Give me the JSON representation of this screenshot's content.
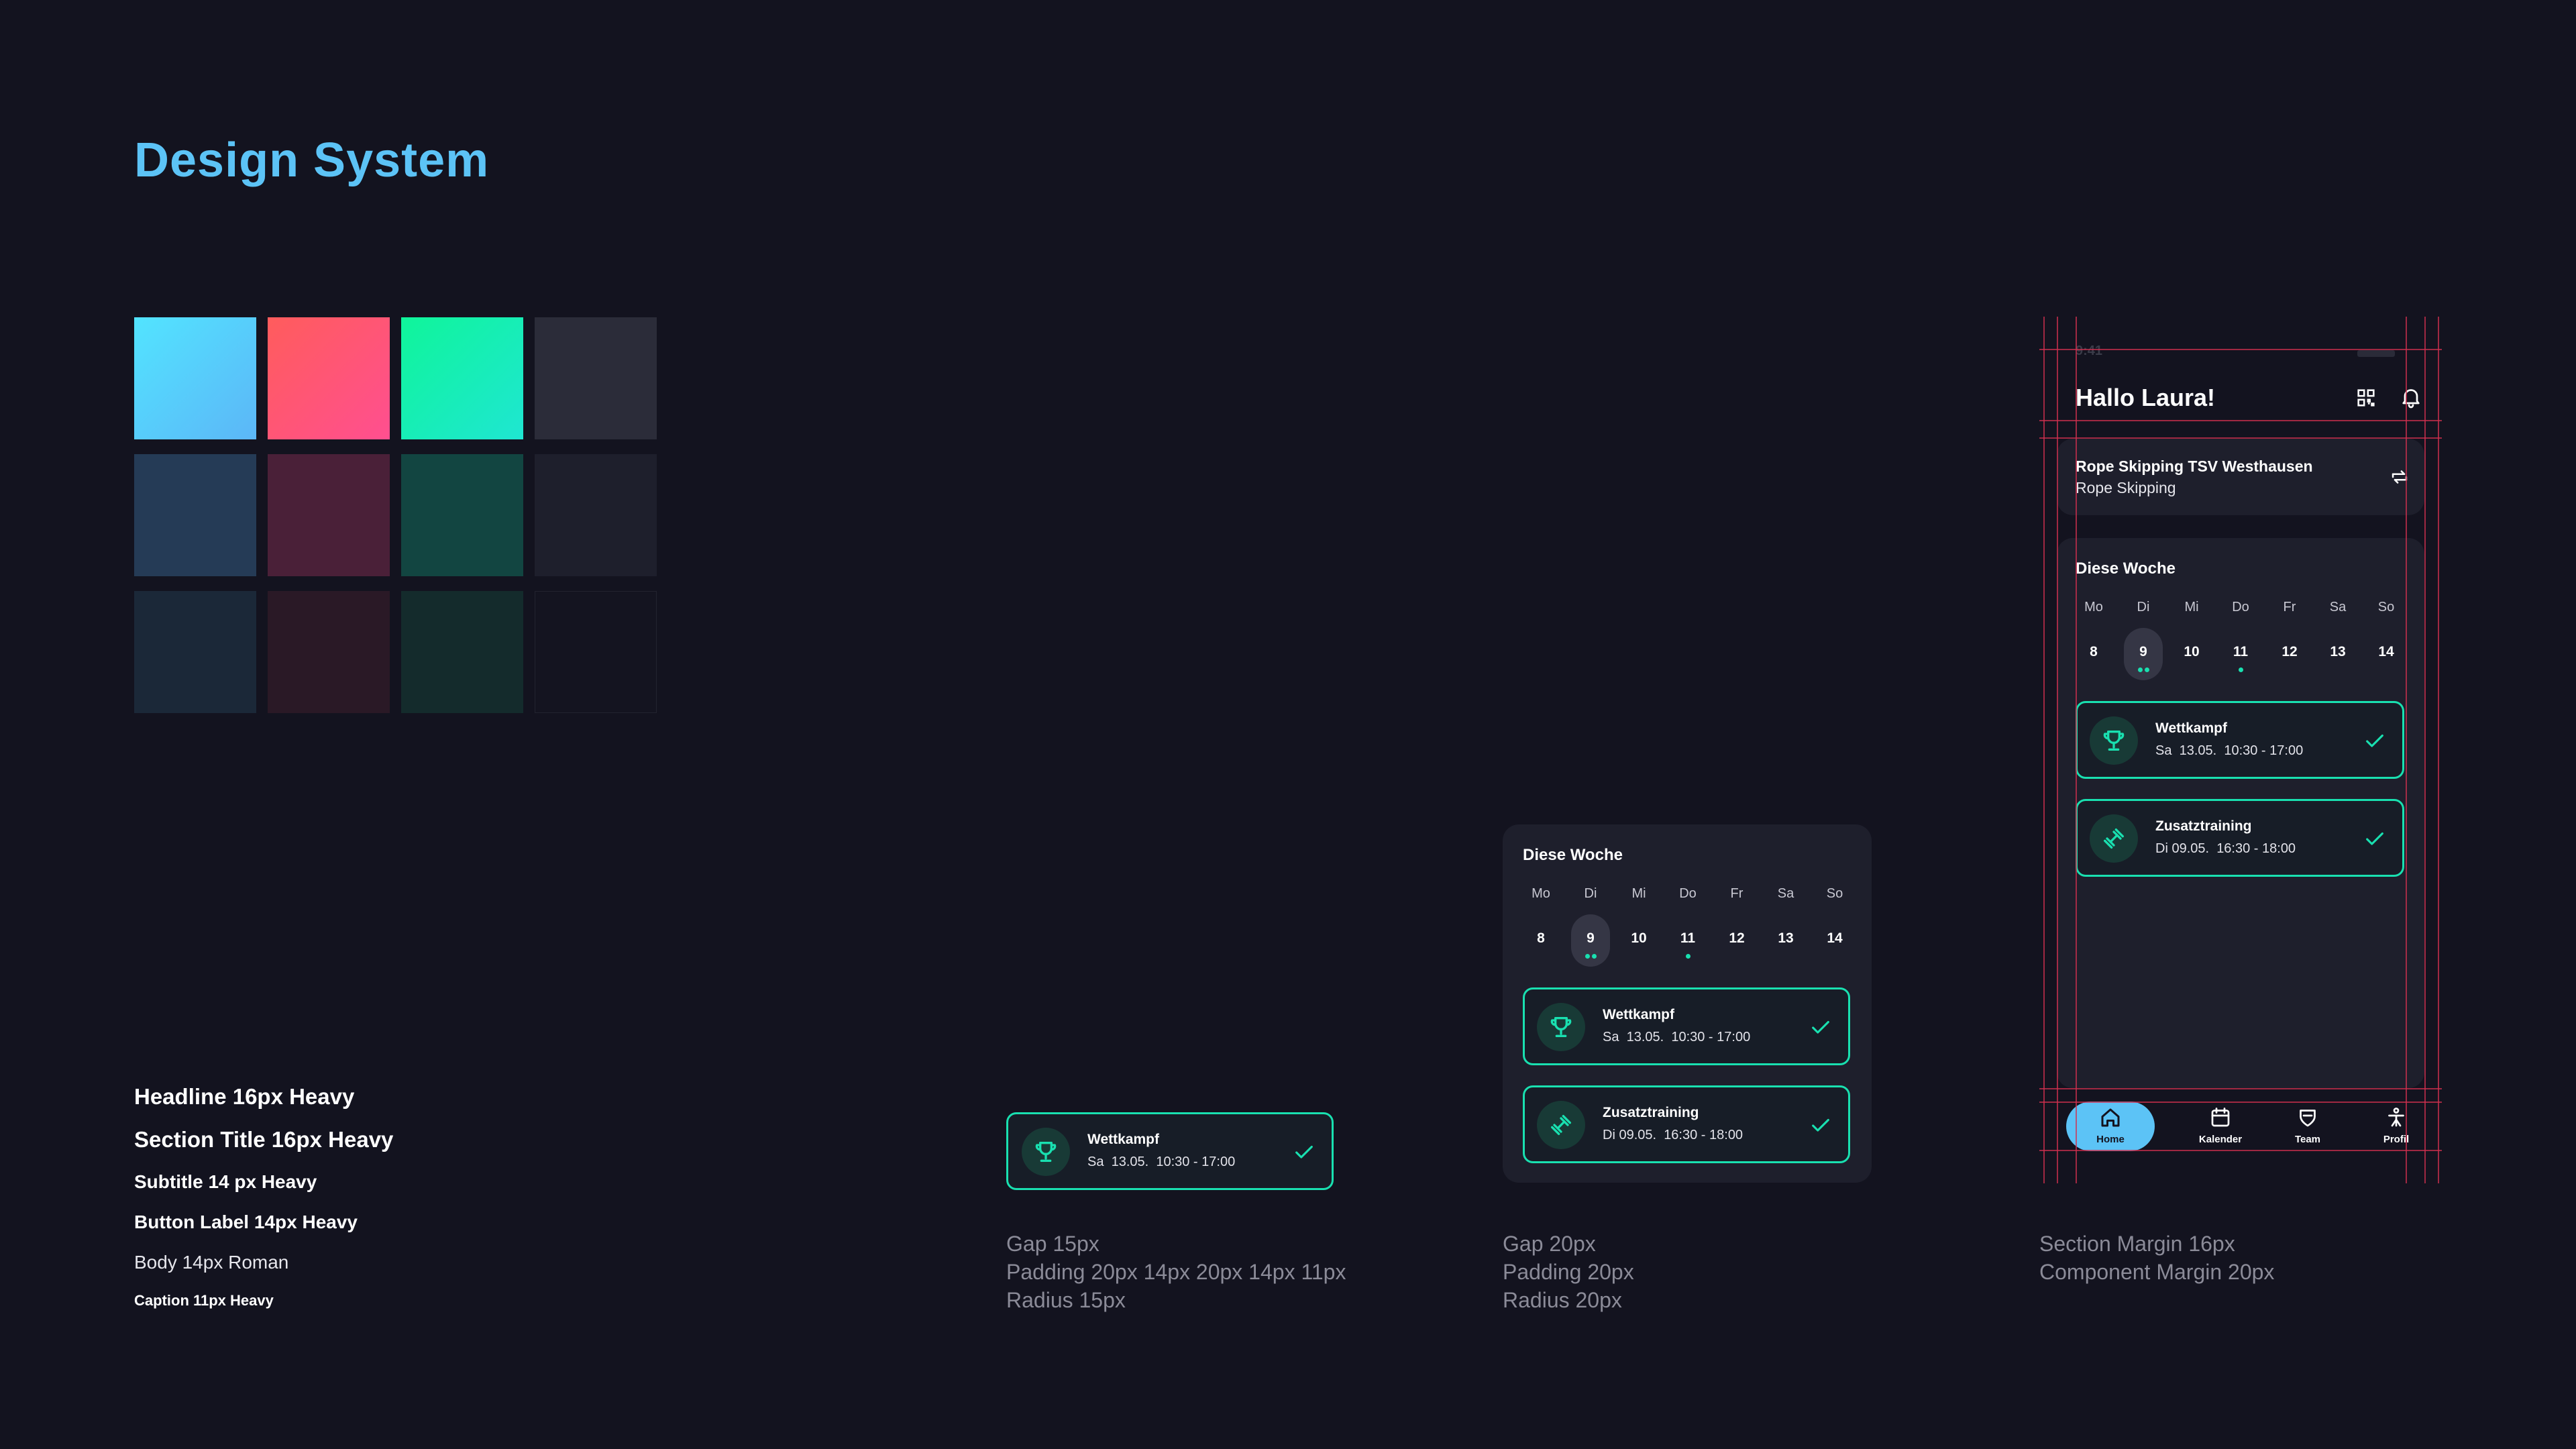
{
  "page": {
    "title": "Design System"
  },
  "colors": {
    "row1": [
      "#4fd8fb",
      "#fa5a6e",
      "#17f5b2",
      "#2b2c39"
    ],
    "row2": [
      "#253b56",
      "#4a2038",
      "#124541",
      "#1e1f2c"
    ],
    "row3": [
      "#1b2838",
      "#2a1926",
      "#142b2c",
      "#141420"
    ]
  },
  "typography": {
    "headline": "Headline 16px Heavy",
    "section_title": "Section Title 16px Heavy",
    "subtitle": "Subtitle 14 px Heavy",
    "button_label": "Button Label 14px Heavy",
    "body": "Body 14px Roman",
    "caption": "Caption 11px Heavy"
  },
  "card_spec": {
    "event": {
      "title": "Wettkampf",
      "day": "Sa",
      "date": "13.05.",
      "time": "10:30 - 17:00",
      "icon": "trophy-icon"
    },
    "lines": [
      "Gap 15px",
      "Padding 20px 14px 20px 14px 11px",
      "Radius 15px"
    ]
  },
  "week": {
    "title": "Diese Woche",
    "days": [
      {
        "label": "Mo",
        "num": "8",
        "selected": false,
        "dots": 0
      },
      {
        "label": "Di",
        "num": "9",
        "selected": true,
        "dots": 2
      },
      {
        "label": "Mi",
        "num": "10",
        "selected": false,
        "dots": 0
      },
      {
        "label": "Do",
        "num": "11",
        "selected": false,
        "dots": 1
      },
      {
        "label": "Fr",
        "num": "12",
        "selected": false,
        "dots": 0
      },
      {
        "label": "Sa",
        "num": "13",
        "selected": false,
        "dots": 0
      },
      {
        "label": "So",
        "num": "14",
        "selected": false,
        "dots": 0
      }
    ],
    "events": [
      {
        "title": "Wettkampf",
        "day": "Sa",
        "date": "13.05.",
        "time": "10:30 - 17:00",
        "icon": "trophy-icon"
      },
      {
        "title": "Zusatztraining",
        "day": "Di",
        "date": "09.05.",
        "time": "16:30 - 18:00",
        "icon": "dumbbell-icon"
      }
    ]
  },
  "week_spec": {
    "lines": [
      "Gap 20px",
      "Padding 20px",
      "Radius 20px"
    ]
  },
  "phone": {
    "status_time": "9:41",
    "greeting": "Hallo Laura!",
    "club": {
      "name": "Rope Skipping TSV Westhausen",
      "sport": "Rope Skipping"
    },
    "nav": [
      {
        "label": "Home",
        "icon": "home-icon",
        "active": true
      },
      {
        "label": "Kalender",
        "icon": "calendar-icon",
        "active": false
      },
      {
        "label": "Team",
        "icon": "team-shield-icon",
        "active": false
      },
      {
        "label": "Profil",
        "icon": "profile-icon",
        "active": false
      }
    ]
  },
  "phone_spec": {
    "lines": [
      "Section Margin 16px",
      "Component Margin 20px"
    ]
  }
}
